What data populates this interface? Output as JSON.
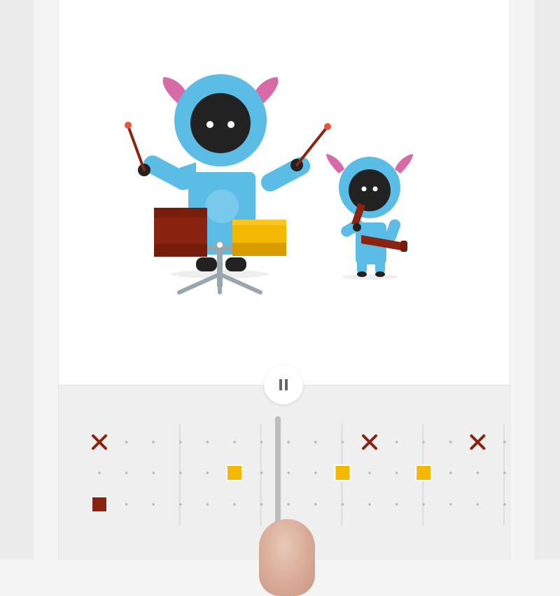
{
  "app": {
    "name": "rhythm-monsters-sequencer"
  },
  "colors": {
    "monster_body": "#5bbde6",
    "monster_face": "#222222",
    "monster_horn": "#d76aa7",
    "drum_dark": "#8a2410",
    "drum_yellow": "#f5b800",
    "stick_tip": "#e8553a",
    "stand": "#9aa6ae",
    "playhead": "#bdbdbd",
    "grid_bg": "#efefef"
  },
  "controls": {
    "pause_icon": "pause-icon",
    "state": "playing"
  },
  "sequencer": {
    "steps": 16,
    "playhead_step": 8,
    "rows": [
      {
        "name": "cymbal",
        "marker": "x-icon",
        "active_steps": [
          0,
          10,
          14
        ]
      },
      {
        "name": "yellow-drum",
        "marker": "square-yellow",
        "active_steps": [
          5,
          9,
          12
        ]
      },
      {
        "name": "dark-drum",
        "marker": "square-dark",
        "active_steps": [
          0
        ]
      }
    ]
  }
}
